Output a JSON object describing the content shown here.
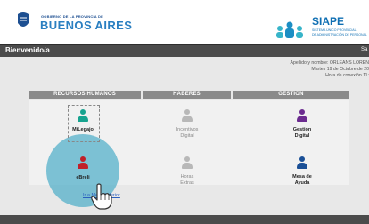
{
  "header": {
    "gov_subtitle": "GOBIERNO DE LA PROVINCIA DE",
    "gov_title": "BUENOS AIRES",
    "siape_title": "SIAPE",
    "siape_sub_line1": "SISTEMA ÚNICO PROVINCIAL",
    "siape_sub_line2": "DE ADMINISTRACIÓN DE PERSONAL"
  },
  "welcome_bar": {
    "greeting": "Bienvenido/a",
    "right_text": "Sa"
  },
  "user_info": {
    "line1": "Apellido y nombre: ORLEANS LOREN",
    "line2": "Martes 19 de Octubre de 20",
    "line3": "Hora de conexión 11:"
  },
  "columns": {
    "col1": "RECURSOS HUMANOS",
    "col2": "HABERES",
    "col3": "GESTION"
  },
  "items": {
    "milegajo": "MiLegajo",
    "incentivos_l1": "Incentivos",
    "incentivos_l2": "Digital",
    "gestion_l1": "Gestión",
    "gestion_l2": "Digital",
    "ebreli": "eBreli",
    "horas_l1": "Horas",
    "horas_l2": "Extras",
    "mesa_l1": "Mesa de",
    "mesa_l2": "Ayuda"
  },
  "footer_link": "Ir a Menú Inferior",
  "colors": {
    "teal": "#17a38f",
    "gray": "#b8b8b8",
    "purple": "#6b2b8f",
    "red": "#c0202a",
    "blue": "#1a4f96",
    "bar": "#4b4b4b",
    "header_cell": "#8a8a8a"
  }
}
